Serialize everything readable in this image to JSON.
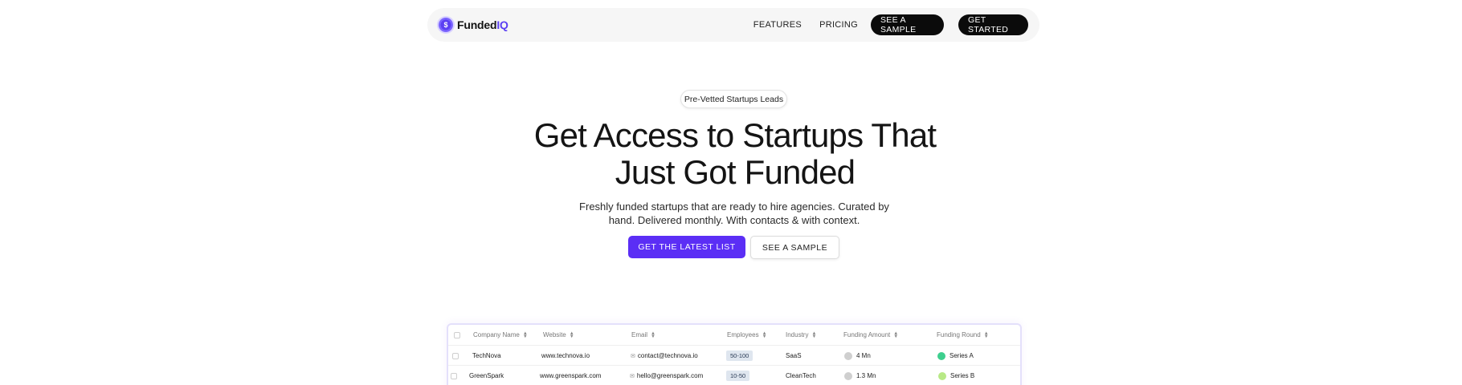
{
  "nav": {
    "brand_prefix": "Funded",
    "brand_suffix": "IQ",
    "logo_glyph": "$",
    "links": [
      "FEATURES",
      "PRICING"
    ],
    "sample_btn": "SEE A SAMPLE",
    "start_btn": "GET STARTED"
  },
  "hero": {
    "pill": "Pre-Vetted Startups Leads",
    "headline_line1": "Get Access to Startups That",
    "headline_line2": "Just Got Funded",
    "sub_line1": "Freshly funded startups that are ready to hire agencies. Curated by",
    "sub_line2": "hand. Delivered monthly. With contacts & with context.",
    "cta_primary": "GET THE LATEST LIST",
    "cta_secondary": "SEE A SAMPLE"
  },
  "table": {
    "columns": [
      "Company Name",
      "Website",
      "Email",
      "Employees",
      "Industry",
      "Funding Amount",
      "Funding Round"
    ],
    "rows": [
      {
        "company": "TechNova",
        "website": "www.technova.io",
        "email": "contact@technova.io",
        "employees": "50-100",
        "industry": "SaaS",
        "amount": "4 Mn",
        "round": "Series A",
        "round_color": "#3ecf8e"
      },
      {
        "company": "GreenSpark",
        "website": "www.greenspark.com",
        "email": "hello@greenspark.com",
        "employees": "10-50",
        "industry": "CleanTech",
        "amount": "1.3 Mn",
        "round": "Series B",
        "round_color": "#b8e986"
      }
    ]
  },
  "colors": {
    "accent": "#5b2ef5",
    "brand_iq": "#5b3ff2",
    "amount_dot": "#cfcfcf"
  }
}
